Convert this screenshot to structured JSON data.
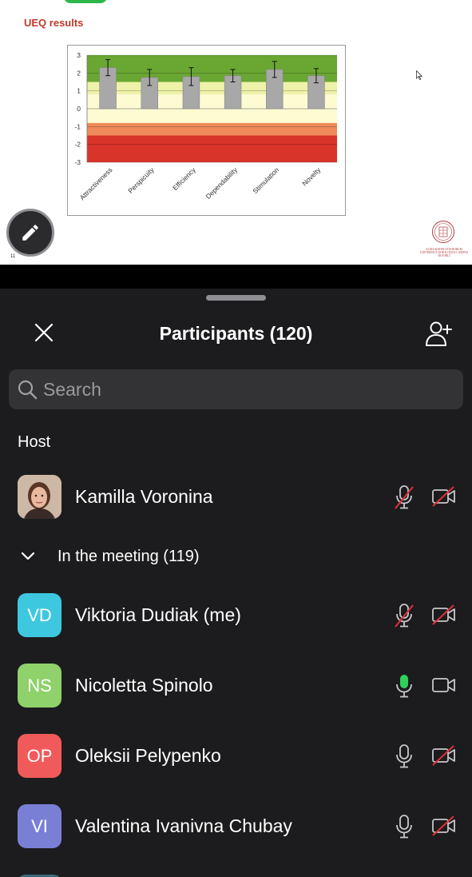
{
  "slide": {
    "title": "UEQ results",
    "page_number": "11",
    "university_text": "ALMA MATER STUDIORUM UNIVERSITÀ DI BOLOGNA CAMPUS DI FORLÌ"
  },
  "chart_data": {
    "type": "bar",
    "categories": [
      "Attractiveness",
      "Perspicuity",
      "Efficiency",
      "Dependability",
      "Stimulation",
      "Novelty"
    ],
    "values": [
      2.3,
      1.75,
      1.8,
      1.85,
      2.2,
      1.85
    ],
    "error": [
      0.45,
      0.45,
      0.5,
      0.35,
      0.45,
      0.4
    ],
    "ylim": [
      -3,
      3
    ],
    "yticks": [
      "3",
      "2",
      "1",
      "0",
      "-1",
      "-2",
      "-3"
    ],
    "bands": [
      {
        "from": 1.5,
        "to": 3,
        "color": "#6aa632"
      },
      {
        "from": 0.8,
        "to": 1.5,
        "color": "#eef2a8"
      },
      {
        "from": -0.8,
        "to": 0.8,
        "color": "#fdfbd2"
      },
      {
        "from": -1.5,
        "to": -0.8,
        "color": "#ef8a5a"
      },
      {
        "from": -3,
        "to": -1.5,
        "color": "#d9342a"
      }
    ],
    "bar_color": "#a8a8a8"
  },
  "panel": {
    "title": "Participants (120)",
    "search_placeholder": "Search",
    "host_section": "Host",
    "meeting_section": "In the meeting (119)"
  },
  "participants": [
    {
      "name": "Kamilla Voronina",
      "initials": "",
      "avatar_color": "#6b4a3a",
      "mic": "muted",
      "camera": "off"
    },
    {
      "name": "Viktoria Dudiak (me)",
      "initials": "VD",
      "avatar_color": "#3ec8e0",
      "mic": "muted",
      "camera": "off"
    },
    {
      "name": "Nicoletta Spinolo",
      "initials": "NS",
      "avatar_color": "#8fd16a",
      "mic": "active",
      "camera": "on"
    },
    {
      "name": "Oleksii Pelypenko",
      "initials": "OP",
      "avatar_color": "#f05a5a",
      "mic": "unmuted",
      "camera": "off"
    },
    {
      "name": "Valentina Ivanivna Chubay",
      "initials": "VI",
      "avatar_color": "#7a7fd6",
      "mic": "unmuted",
      "camera": "off"
    }
  ],
  "colors": {
    "muted_slash": "#e0303a",
    "mic_active": "#2fd15a",
    "icon_gray": "#c7c7cc"
  }
}
